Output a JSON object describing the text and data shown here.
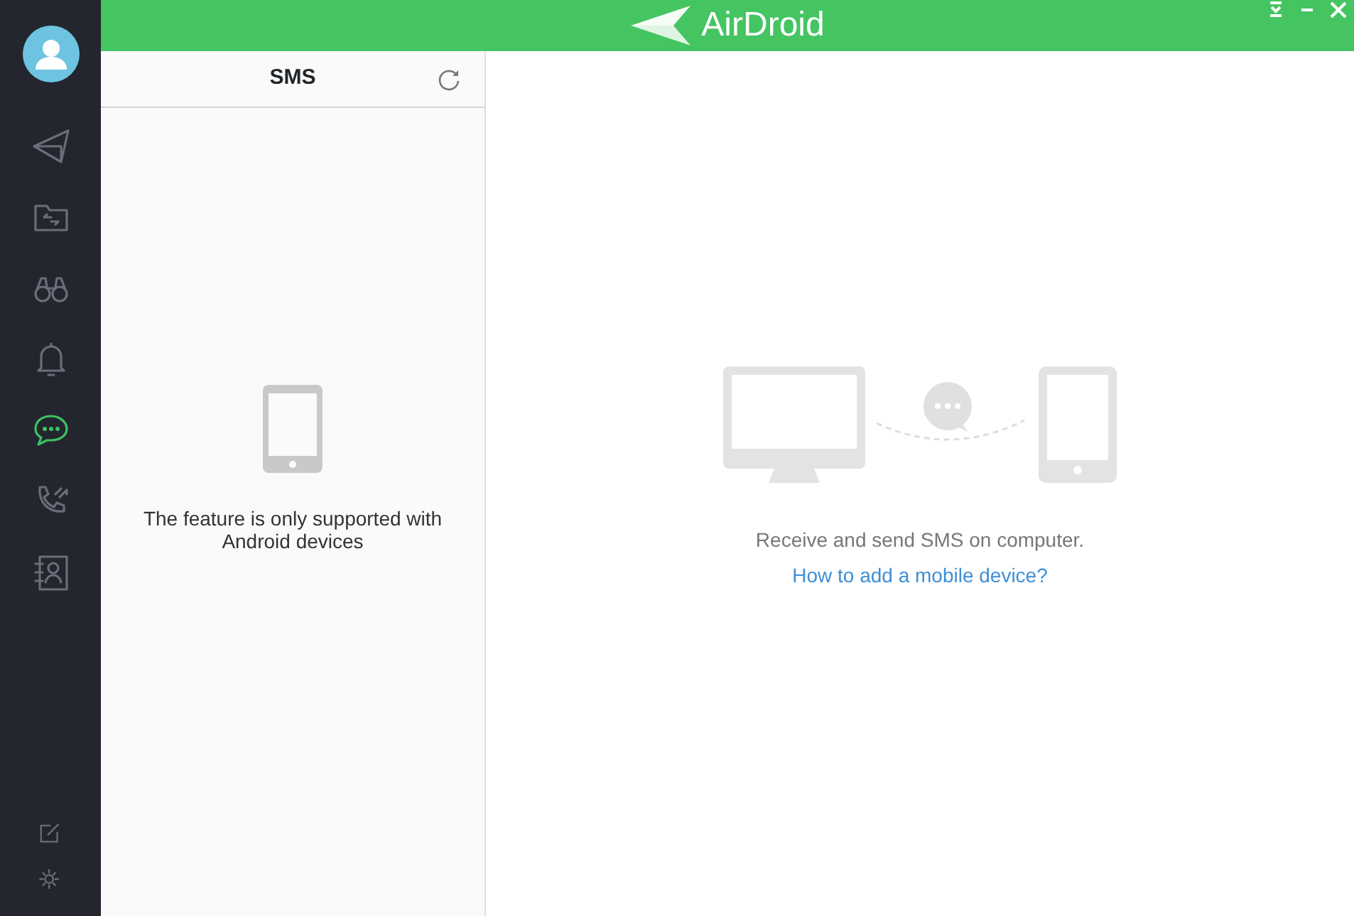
{
  "app": {
    "logo_text": "AirDroid"
  },
  "sidebar": {
    "items": [
      {
        "kind": "send",
        "selected": false
      },
      {
        "kind": "files",
        "selected": false
      },
      {
        "kind": "binoculars",
        "selected": false
      },
      {
        "kind": "bell",
        "selected": false
      },
      {
        "kind": "message",
        "selected": true
      },
      {
        "kind": "calls",
        "selected": false
      },
      {
        "kind": "contacts",
        "selected": false
      }
    ],
    "bottom_items": [
      {
        "kind": "edit"
      },
      {
        "kind": "settings"
      }
    ]
  },
  "panel": {
    "title": "SMS",
    "notice": "The feature is only supported with Android devices"
  },
  "main": {
    "description": "Receive and send SMS on computer.",
    "link": "How to add a mobile device?"
  }
}
